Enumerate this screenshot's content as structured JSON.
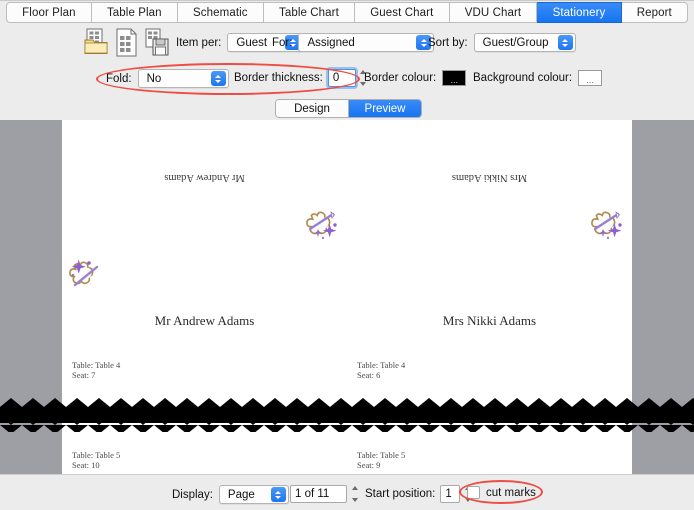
{
  "tabs": [
    {
      "label": "Floor Plan",
      "selected": false
    },
    {
      "label": "Table Plan",
      "selected": false
    },
    {
      "label": "Schematic",
      "selected": false
    },
    {
      "label": "Table Chart",
      "selected": false
    },
    {
      "label": "Guest Chart",
      "selected": false
    },
    {
      "label": "VDU Chart",
      "selected": false
    },
    {
      "label": "Stationery",
      "selected": true
    },
    {
      "label": "Report",
      "selected": false
    }
  ],
  "toolbar": {
    "icons": [
      {
        "name": "open-document-icon",
        "title": "Open"
      },
      {
        "name": "new-document-icon",
        "title": "New"
      },
      {
        "name": "save-document-icon",
        "title": "Save"
      }
    ],
    "item_per_label": "Item per:",
    "item_per_value": "Guest",
    "for_label": "For:",
    "for_value": "Assigned",
    "sort_by_label": "Sort by:",
    "sort_by_value": "Guest/Group",
    "fold_label": "Fold:",
    "fold_value": "No",
    "border_thickness_label": "Border thickness:",
    "border_thickness_value": "0",
    "border_colour_label": "Border colour:",
    "border_colour_swatch": "#000000",
    "border_colour_ellipsis": "...",
    "background_colour_label": "Background colour:",
    "background_colour_swatch": "#ffffff",
    "background_colour_ellipsis": "..."
  },
  "view_mode": {
    "design_label": "Design",
    "preview_label": "Preview",
    "selected": "Preview"
  },
  "preview": {
    "cards": [
      {
        "name": "Mr Andrew Adams",
        "table_line": "Table: Table 4",
        "seat_line": "Seat: 7"
      },
      {
        "name": "Mrs Nikki Adams",
        "table_line": "Table: Table 4",
        "seat_line": "Seat: 6"
      },
      {
        "name": "",
        "table_line": "Table: Table 5",
        "seat_line": "Seat: 10"
      },
      {
        "name": "",
        "table_line": "Table: Table 5",
        "seat_line": "Seat: 9"
      }
    ],
    "ornament_name": "floral-sparkle-ornament"
  },
  "bottombar": {
    "display_label": "Display:",
    "display_value": "Page",
    "page_value": "1 of 11",
    "start_position_label": "Start position:",
    "start_position_value": "1",
    "cut_marks_label": "cut marks",
    "cut_marks_checked": false
  },
  "accent": "#1575f2",
  "highlight_colour": "#ee4d44"
}
